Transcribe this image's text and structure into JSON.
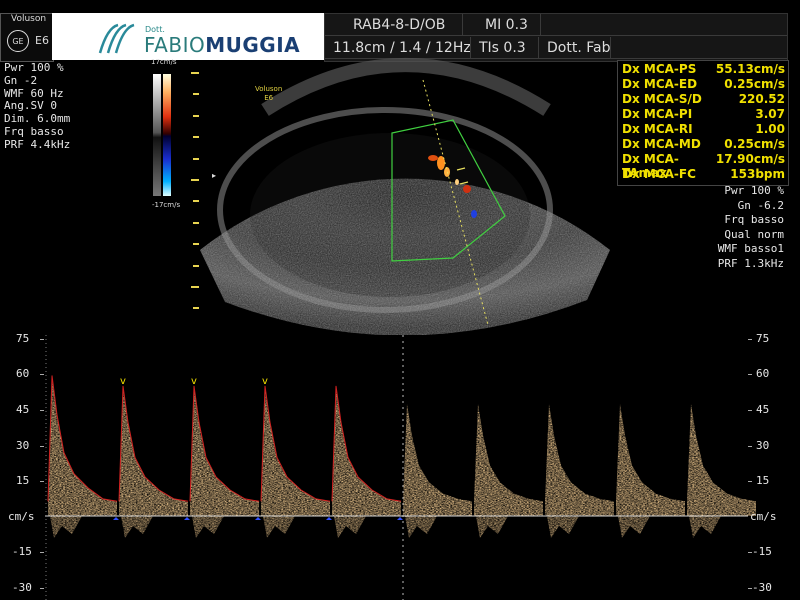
{
  "header": {
    "brand": "Voluson",
    "ge_logo": "GE",
    "model": "E6",
    "logo_dott": "Dott.",
    "logo_name_first": "FABIO",
    "logo_name_last": "MUGGIA",
    "probe": "RAB4-8-D/OB",
    "mi": "MI 0.3",
    "depth_info": "11.8cm / 1.4 / 12Hz",
    "tis": "TIs  0.3",
    "operator": "Dott. Fab"
  },
  "settings_left": [
    "Pwr 100 %",
    "Gn  -2",
    "WMF 60 Hz",
    "Ang.SV  0",
    "Dim.  6.0mm",
    "Frq basso",
    "PRF  4.4kHz"
  ],
  "color_bar": {
    "top_label": "17cm/s",
    "bottom_label": "-17cm/s"
  },
  "image_overlay": {
    "brand": "Voluson",
    "model": "E6"
  },
  "measurements": [
    {
      "label": "Dx MCA-PS",
      "value": "55.13cm/s"
    },
    {
      "label": "Dx MCA-ED",
      "value": "0.25cm/s"
    },
    {
      "label": "Dx MCA-S/D",
      "value": "220.52"
    },
    {
      "label": "Dx MCA-PI",
      "value": "3.07"
    },
    {
      "label": "Dx MCA-RI",
      "value": "1.00"
    },
    {
      "label": "Dx MCA-MD",
      "value": "0.25cm/s"
    },
    {
      "label": "Dx MCA-TAmax",
      "value": "17.90cm/s"
    },
    {
      "label": "Dx MCA-FC",
      "value": "153bpm"
    }
  ],
  "settings_right": [
    "Pwr 100 %",
    "Gn -6.2",
    "Frq basso",
    "Qual norm",
    "WMF basso1",
    "PRF  1.3kHz"
  ],
  "scale": {
    "unit": "cm/s",
    "ticks": [
      "75",
      "60",
      "45",
      "30",
      "15",
      "-15",
      "-30"
    ]
  },
  "colors": {
    "measure_text": "#f0e000",
    "doppler": "#f0a040",
    "trace": "#d02020",
    "gate": "#40d040"
  },
  "chart_data": {
    "type": "line",
    "ylim": [
      -30,
      75
    ],
    "yticks": [
      75,
      60,
      45,
      30,
      15,
      0,
      -15,
      -30
    ],
    "unit": "cm/s",
    "peak_velocity": 55.13,
    "end_diastolic_velocity": 0.25,
    "heart_rate_bpm": 153,
    "cycles_traced": 5,
    "cycles_live": 5
  }
}
